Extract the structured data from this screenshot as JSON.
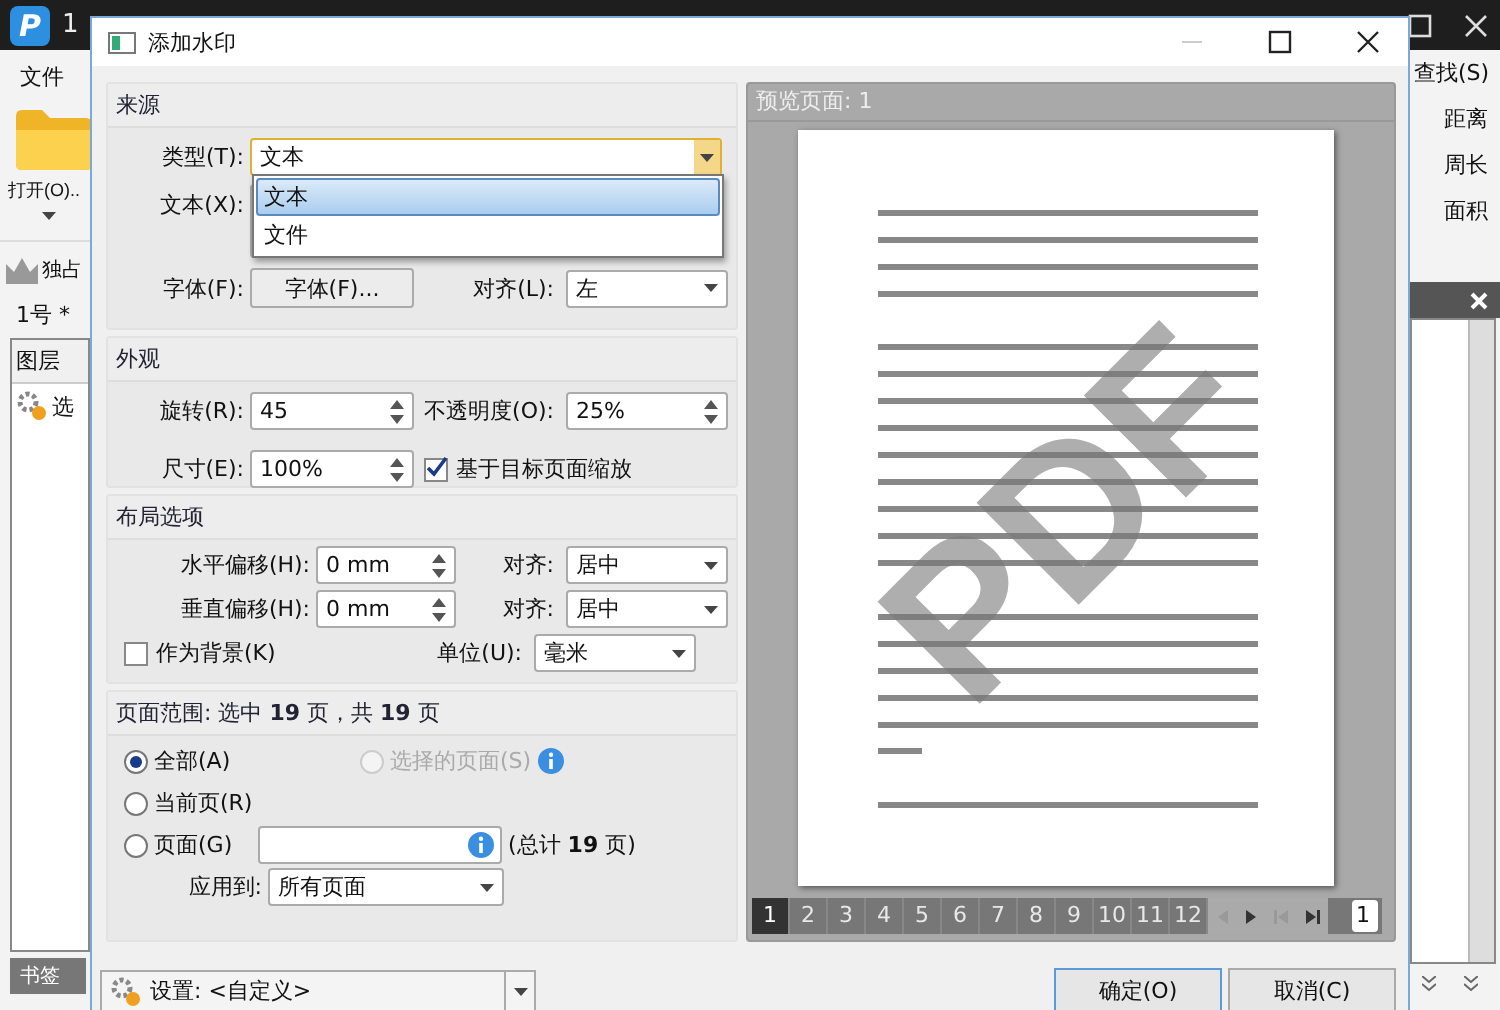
{
  "app": {
    "logo": "P",
    "title": "1",
    "menu": "文件",
    "open_button": "打开(O)..",
    "toolbar_item": "独占",
    "document_tab": "1号 *",
    "panel_title": "图层",
    "panel_item": "选",
    "bottom_tab": "书签",
    "right_items": [
      "查找(S)",
      "距离",
      "周长",
      "面积"
    ]
  },
  "dialog": {
    "title": "添加水印",
    "source": {
      "title": "来源",
      "type_label": "类型(T):",
      "type_value": "文本",
      "type_options": [
        {
          "label": "文本",
          "selected": true
        },
        {
          "label": "文件",
          "selected": false
        }
      ],
      "text_label": "文本(X):",
      "font_label": "字体(F):",
      "font_button": "字体(F)...",
      "align_label": "对齐(L):",
      "align_value": "左"
    },
    "appearance": {
      "title": "外观",
      "rotation_label": "旋转(R):",
      "rotation": "45",
      "opacity_label": "不透明度(O):",
      "opacity": "25%",
      "size_label": "尺寸(E):",
      "size": "100%",
      "scale_to_page": {
        "label": "基于目标页面缩放",
        "checked": true
      }
    },
    "layout": {
      "title": "布局选项",
      "h_offset_label": "水平偏移(H):",
      "h_offset": "0 mm",
      "h_align_label": "对齐:",
      "h_align": "居中",
      "v_offset_label": "垂直偏移(H):",
      "v_offset": "0 mm",
      "v_align_label": "对齐:",
      "v_align": "居中",
      "background": {
        "label": "作为背景(K)",
        "checked": false
      },
      "unit_label": "单位(U):",
      "unit": "毫米"
    },
    "page_range": {
      "title": "页面范围: 选中 **19** 页，共 **19** 页",
      "options": [
        {
          "label": "全部(A)",
          "selected": true,
          "disabled": false
        },
        {
          "label": "选择的页面(S)",
          "selected": false,
          "disabled": true
        },
        {
          "label": "当前页(R)",
          "selected": false,
          "disabled": false
        },
        {
          "label": "页面(G)",
          "selected": false,
          "disabled": false
        }
      ],
      "total": "(总计 **19** 页)",
      "apply_label": "应用到:",
      "apply_value": "所有页面"
    },
    "preview": {
      "title": "预览页面: 1",
      "watermark": "PDF",
      "pages": [
        {
          "label": "1",
          "selected": true
        },
        {
          "label": "2",
          "selected": false
        },
        {
          "label": "3",
          "selected": false
        },
        {
          "label": "4",
          "selected": false
        },
        {
          "label": "5",
          "selected": false
        },
        {
          "label": "6",
          "selected": false
        },
        {
          "label": "7",
          "selected": false
        },
        {
          "label": "8",
          "selected": false
        },
        {
          "label": "9",
          "selected": false
        },
        {
          "label": "10",
          "selected": false
        },
        {
          "label": "11",
          "selected": false
        },
        {
          "label": "12",
          "selected": false
        }
      ],
      "page_input": "1"
    },
    "settings": "设置: <自定义>",
    "buttons": [
      "确定(O)",
      "取消(C)"
    ]
  }
}
